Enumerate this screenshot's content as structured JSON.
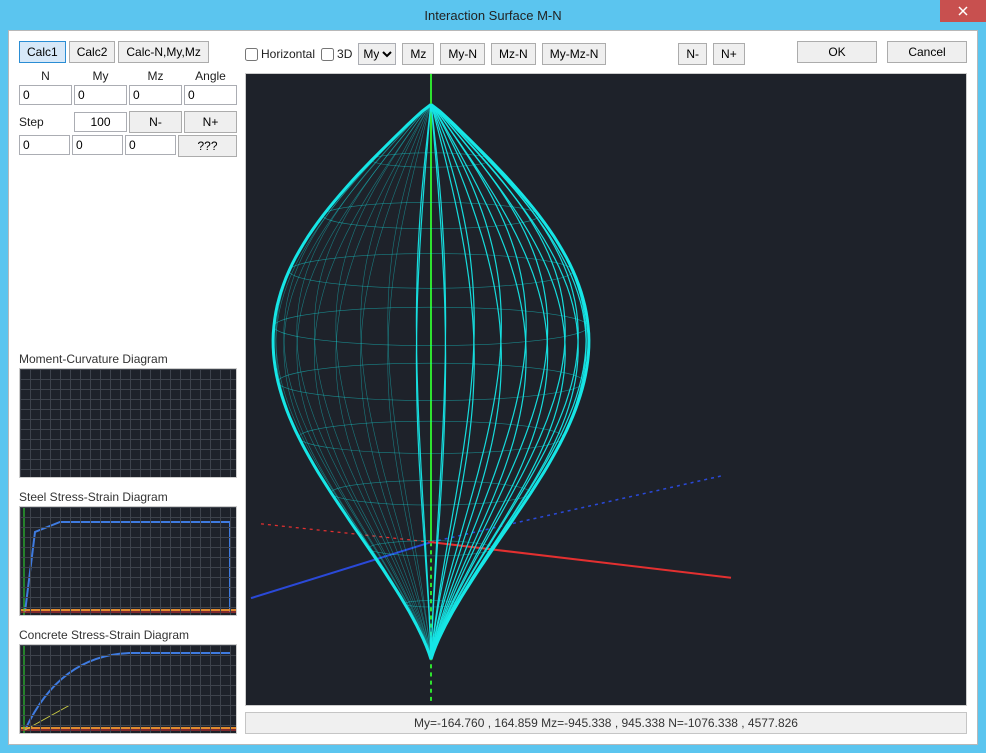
{
  "window": {
    "title": "Interaction Surface M-N"
  },
  "left": {
    "calc_buttons": {
      "calc1": "Calc1",
      "calc2": "Calc2",
      "calc_nmymz": "Calc-N,My,Mz"
    },
    "headers": {
      "n": "N",
      "my": "My",
      "mz": "Mz",
      "angle": "Angle"
    },
    "row1": {
      "n": "0",
      "my": "0",
      "mz": "0",
      "angle": "0"
    },
    "step_label": "Step",
    "step_value": "100",
    "n_minus": "N-",
    "n_plus": "N+",
    "row2": {
      "a": "0",
      "b": "0",
      "c": "0"
    },
    "qqq": "???",
    "mini": {
      "moment_curvature": "Moment-Curvature Diagram",
      "steel_stress_strain": "Steel Stress-Strain Diagram",
      "concrete_stress_strain": "Concrete Stress-Strain Diagram"
    }
  },
  "top": {
    "horizontal": "Horizontal",
    "three_d": "3D",
    "plane_dropdown_selected": "My",
    "mz_btn": "Mz",
    "my_n": "My-N",
    "mz_n": "Mz-N",
    "my_mz_n": "My-Mz-N",
    "n_minus": "N-",
    "n_plus": "N+",
    "ok": "OK",
    "cancel": "Cancel"
  },
  "status": {
    "text": "My=-164.760 , 164.859 Mz=-945.338 , 945.338 N=-1076.338 , 4577.826"
  },
  "colors": {
    "canvas_bg": "#1E222A",
    "grid": "#3E434C",
    "surface": "#16E6E6",
    "axis_green": "#2FE22F",
    "axis_red": "#E33030",
    "axis_blue": "#2A49D8",
    "steel_curve": "#3F7BE0",
    "steel_orange": "#E08A2E",
    "concrete_curve": "#3F7BE0"
  },
  "chart_data": {
    "type": "line",
    "title": "Interaction Surface M-N",
    "series_note": "3D interaction surface (onion-shaped) rendered as stacked contour ellipses along N-axis; solid axes: green=vertical (N), red and blue = moment axes projected; dashed segments are rear edges.",
    "My_range": [
      -164.76,
      164.859
    ],
    "Mz_range": [
      -945.338,
      945.338
    ],
    "N_range": [
      -1076.338,
      4577.826
    ]
  }
}
